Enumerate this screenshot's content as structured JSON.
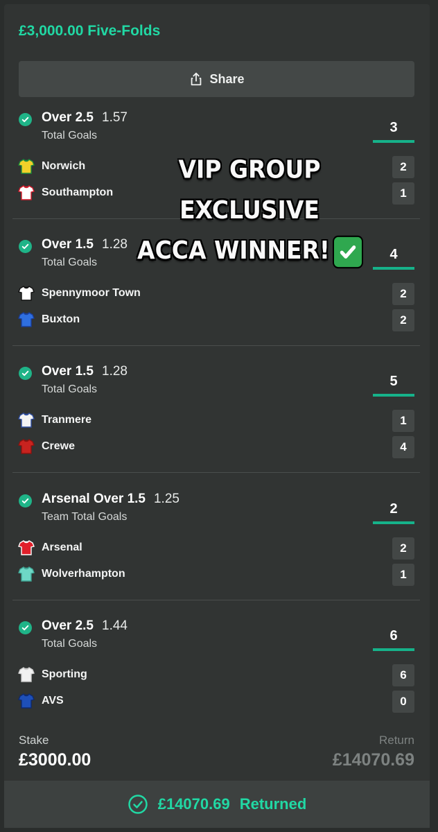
{
  "bet": {
    "title": "£3,000.00 Five-Folds",
    "share_label": "Share"
  },
  "legs": [
    {
      "market": "Over 2.5",
      "odds": "1.57",
      "sub": "Total Goals",
      "total": "3",
      "home": {
        "name": "Norwich",
        "score": "2",
        "kit_color": "#f2d12a",
        "kit_trim": "#1d8a3c"
      },
      "away": {
        "name": "Southampton",
        "score": "1",
        "kit_color": "#ffffff",
        "kit_trim": "#d41c2c"
      }
    },
    {
      "market": "Over 1.5",
      "odds": "1.28",
      "sub": "Total Goals",
      "total": "4",
      "home": {
        "name": "Spennymoor Town",
        "score": "2",
        "kit_color": "#ffffff",
        "kit_trim": "#111111"
      },
      "away": {
        "name": "Buxton",
        "score": "2",
        "kit_color": "#2f6fe0",
        "kit_trim": "#1a3e9a"
      }
    },
    {
      "market": "Over 1.5",
      "odds": "1.28",
      "sub": "Total Goals",
      "total": "5",
      "home": {
        "name": "Tranmere",
        "score": "1",
        "kit_color": "#f4f4f4",
        "kit_trim": "#2f4ea0"
      },
      "away": {
        "name": "Crewe",
        "score": "4",
        "kit_color": "#c8231f",
        "kit_trim": "#8a1310"
      }
    },
    {
      "market": "Arsenal Over 1.5",
      "odds": "1.25",
      "sub": "Team Total Goals",
      "total": "2",
      "home": {
        "name": "Arsenal",
        "score": "2",
        "kit_color": "#e0202a",
        "kit_trim": "#ffffff"
      },
      "away": {
        "name": "Wolverhampton",
        "score": "1",
        "kit_color": "#6ed8c6",
        "kit_trim": "#3ea392"
      }
    },
    {
      "market": "Over 2.5",
      "odds": "1.44",
      "sub": "Total Goals",
      "total": "6",
      "home": {
        "name": "Sporting",
        "score": "6",
        "kit_color": "#f2f2f2",
        "kit_trim": "#cccccc"
      },
      "away": {
        "name": "AVS",
        "score": "0",
        "kit_color": "#1e4fb8",
        "kit_trim": "#0e2a6e"
      }
    }
  ],
  "overlay": {
    "line1": "VIP GROUP EXCLUSIVE",
    "line2": "ACCA WINNER!",
    "icon": "check-mark-emoji-icon"
  },
  "footer": {
    "stake_label": "Stake",
    "stake_value": "£3000.00",
    "return_label": "Return",
    "return_value": "£14070.69",
    "returned_amount": "£14070.69",
    "returned_label": "Returned"
  },
  "colors": {
    "accent": "#21d8a4",
    "background": "#313433",
    "check": "#1fb488"
  }
}
